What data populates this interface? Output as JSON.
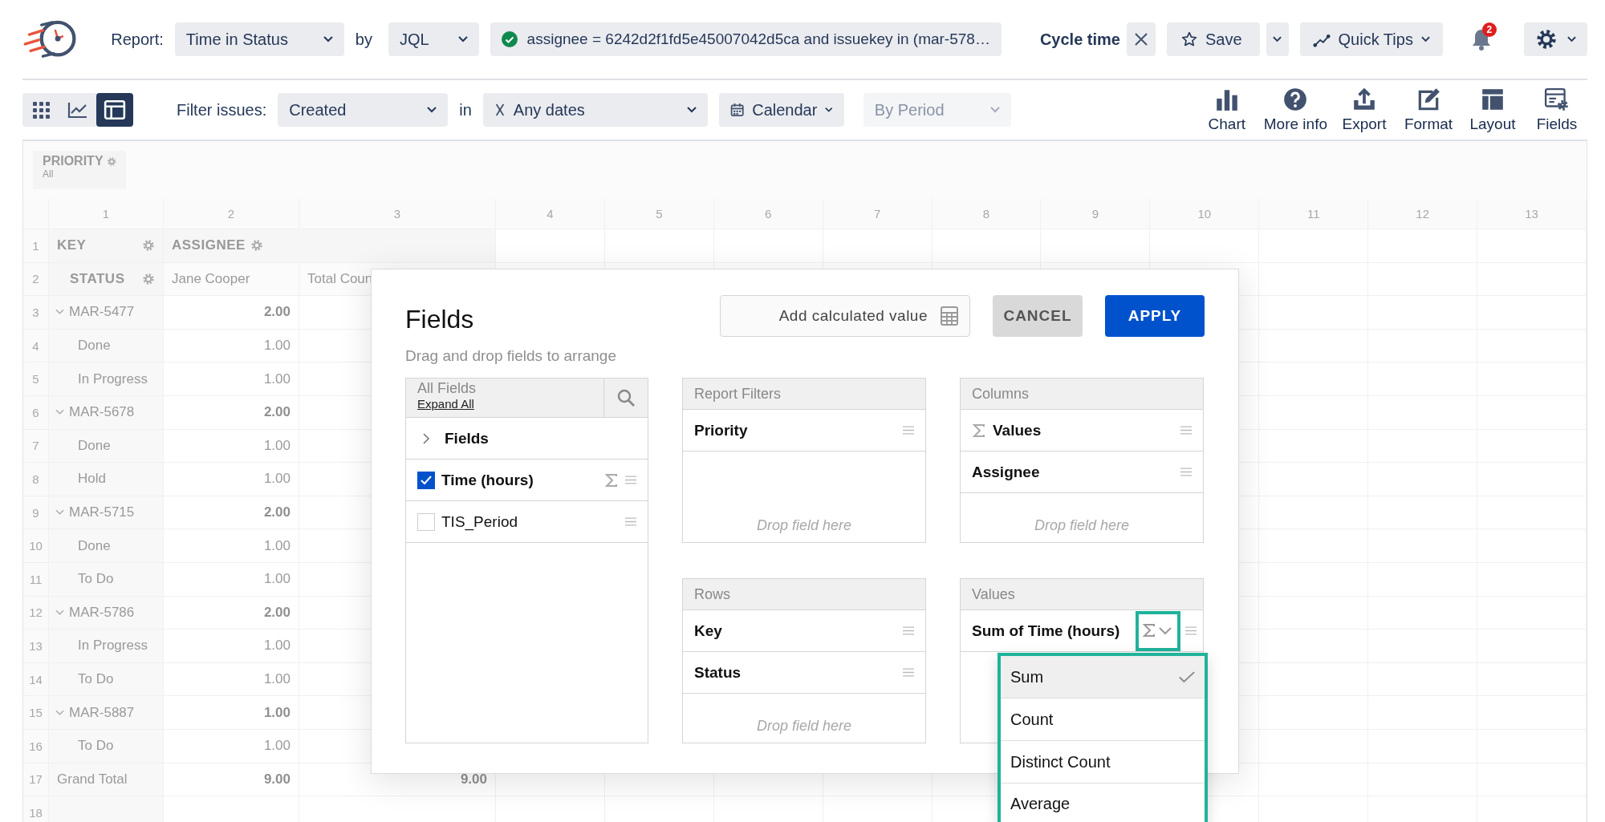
{
  "toolbar": {
    "report_label": "Report:",
    "report": "Time in Status",
    "by_label": "by",
    "by": "JQL",
    "query": "assignee = 6242d2f1fd5e45007042d5ca and issuekey in (mar-578…",
    "query_valid": true,
    "cycle_label": "Cycle time",
    "save": "Save",
    "quick_tips": "Quick Tips",
    "notifications": "2"
  },
  "filter_bar": {
    "views": [
      {
        "kind": "grid",
        "selected": false
      },
      {
        "kind": "chart",
        "selected": false
      },
      {
        "kind": "table",
        "selected": true
      }
    ],
    "filter_label": "Filter issues:",
    "filter": "Created",
    "in_label": "in",
    "dates": "Any dates",
    "calendar": "Calendar",
    "period": "By Period",
    "period_disabled": true,
    "actions": [
      {
        "kind": "chart",
        "label": "Chart"
      },
      {
        "kind": "info",
        "label": "More info"
      },
      {
        "kind": "export",
        "label": "Export"
      },
      {
        "kind": "format",
        "label": "Format"
      },
      {
        "kind": "layout",
        "label": "Layout"
      },
      {
        "kind": "fields",
        "label": "Fields"
      }
    ]
  },
  "grid": {
    "filter": {
      "label": "PRIORITY",
      "value": "All"
    },
    "column_numbers": [
      "1",
      "2",
      "3",
      "4",
      "5",
      "6",
      "7",
      "8",
      "9",
      "10",
      "11",
      "12",
      "13"
    ],
    "rows": [
      {
        "number": "1",
        "kind": "header",
        "label": "KEY",
        "value": "ASSIGNEE"
      },
      {
        "number": "2",
        "kind": "subheader",
        "label": "STATUS",
        "value": "Jane Cooper",
        "total": "Total Coun"
      },
      {
        "number": "3",
        "kind": "group",
        "label": "MAR-5477",
        "value": "2.00"
      },
      {
        "number": "4",
        "kind": "item",
        "label": "Done",
        "value": "1.00"
      },
      {
        "number": "5",
        "kind": "item",
        "label": "In Progress",
        "value": "1.00"
      },
      {
        "number": "6",
        "kind": "group",
        "label": "MAR-5678",
        "value": "2.00"
      },
      {
        "number": "7",
        "kind": "item",
        "label": "Done",
        "value": "1.00"
      },
      {
        "number": "8",
        "kind": "item",
        "label": "Hold",
        "value": "1.00"
      },
      {
        "number": "9",
        "kind": "group",
        "label": "MAR-5715",
        "value": "2.00"
      },
      {
        "number": "10",
        "kind": "item",
        "label": "Done",
        "value": "1.00"
      },
      {
        "number": "11",
        "kind": "item",
        "label": "To Do",
        "value": "1.00"
      },
      {
        "number": "12",
        "kind": "group",
        "label": "MAR-5786",
        "value": "2.00"
      },
      {
        "number": "13",
        "kind": "item",
        "label": "In Progress",
        "value": "1.00"
      },
      {
        "number": "14",
        "kind": "item",
        "label": "To Do",
        "value": "1.00"
      },
      {
        "number": "15",
        "kind": "group",
        "label": "MAR-5887",
        "value": "1.00"
      },
      {
        "number": "16",
        "kind": "item",
        "label": "To Do",
        "value": "1.00"
      },
      {
        "number": "17",
        "kind": "total",
        "label": "Grand Total",
        "value": "9.00",
        "total": "9.00"
      },
      {
        "number": "18",
        "kind": "empty"
      }
    ]
  },
  "fields_dialog": {
    "title": "Fields",
    "subtitle": "Drag and drop fields to arrange",
    "add_calculated": "Add calculated value",
    "cancel": "CANCEL",
    "apply": "APPLY",
    "all_fields": {
      "title": "All Fields",
      "expand": "Expand All",
      "items": [
        {
          "kind": "folder",
          "label": "Fields",
          "expanded": false
        },
        {
          "kind": "field",
          "label": "Time (hours)",
          "checked": true,
          "sigma": true
        },
        {
          "kind": "field",
          "label": "TIS_Period",
          "checked": false,
          "sigma": false
        }
      ]
    },
    "report_filters": {
      "title": "Report Filters",
      "items": [
        {
          "label": "Priority",
          "sigma": false
        }
      ],
      "drop_hint": "Drop field here"
    },
    "columns": {
      "title": "Columns",
      "items": [
        {
          "label": "Values",
          "sigma": true
        },
        {
          "label": "Assignee",
          "sigma": false
        }
      ],
      "drop_hint": "Drop field here"
    },
    "rows": {
      "title": "Rows",
      "items": [
        {
          "label": "Key",
          "sigma": false
        },
        {
          "label": "Status",
          "sigma": false
        }
      ],
      "drop_hint": "Drop field here"
    },
    "values": {
      "title": "Values",
      "items": [
        {
          "label": "Sum of Time (hours)",
          "sigma": false,
          "menu": true
        }
      ]
    },
    "aggregation_menu": [
      {
        "label": "Sum",
        "selected": true
      },
      {
        "label": "Count",
        "selected": false
      },
      {
        "label": "Distinct Count",
        "selected": false
      },
      {
        "label": "Average",
        "selected": false
      }
    ]
  }
}
